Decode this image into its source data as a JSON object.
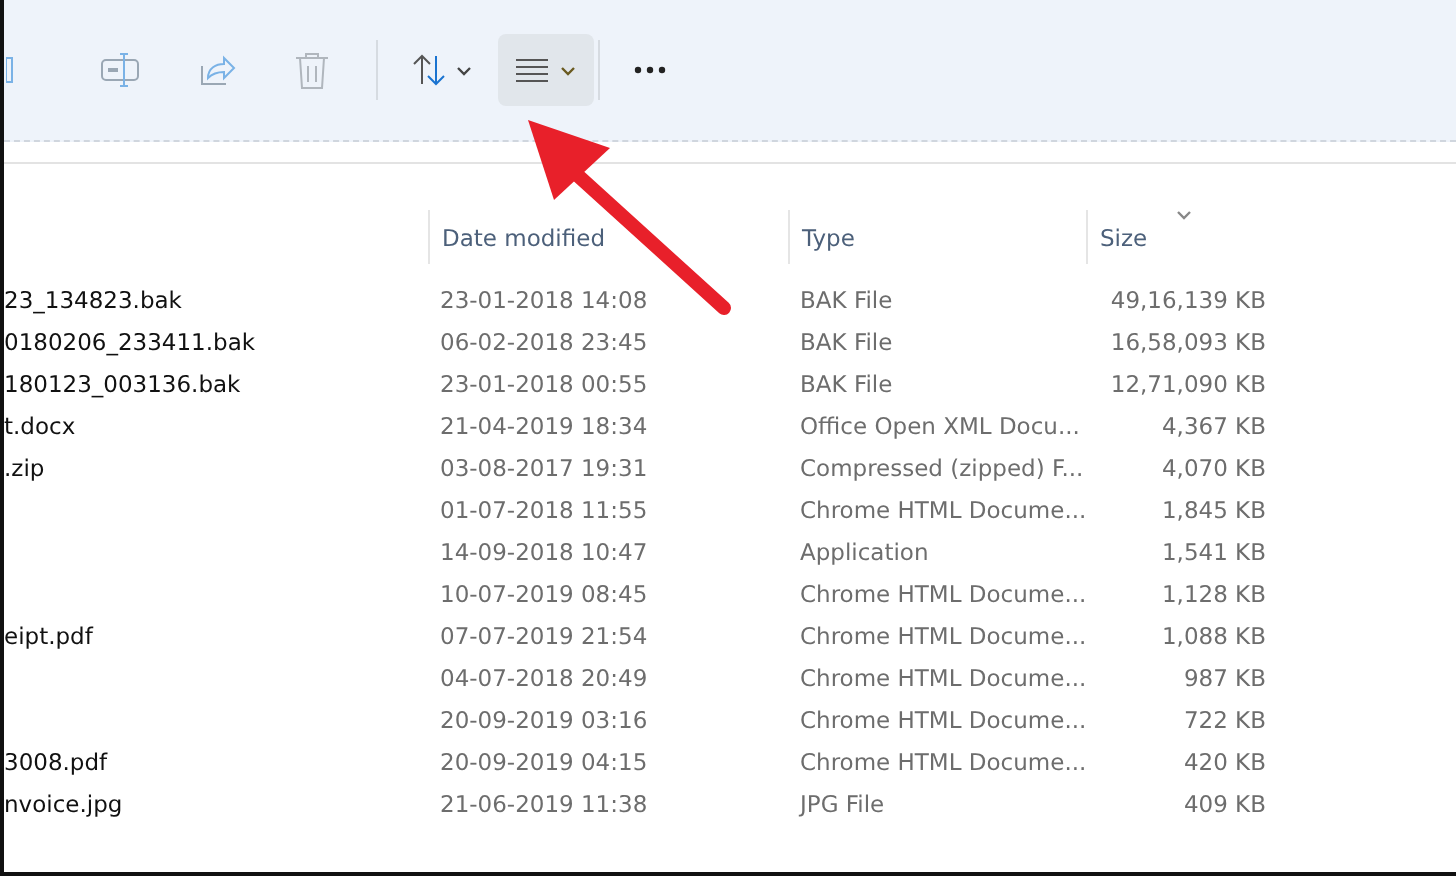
{
  "toolbar": {
    "view_button": {
      "selected": true
    }
  },
  "table": {
    "columns": [
      "Date modified",
      "Type",
      "Size"
    ],
    "rows": [
      {
        "name": "23_134823.bak",
        "date": "23-01-2018 14:08",
        "type": "BAK File",
        "size": "49,16,139 KB"
      },
      {
        "name": "0180206_233411.bak",
        "date": "06-02-2018 23:45",
        "type": "BAK File",
        "size": "16,58,093 KB"
      },
      {
        "name": "180123_003136.bak",
        "date": "23-01-2018 00:55",
        "type": "BAK File",
        "size": "12,71,090 KB"
      },
      {
        "name": "t.docx",
        "date": "21-04-2019 18:34",
        "type": "Office Open XML Docu...",
        "size": "4,367 KB"
      },
      {
        "name": ".zip",
        "date": "03-08-2017 19:31",
        "type": "Compressed (zipped) F...",
        "size": "4,070 KB"
      },
      {
        "date": "01-07-2018 11:55",
        "type": "Chrome HTML Docume...",
        "size": "1,845 KB"
      },
      {
        "date": "14-09-2018 10:47",
        "type": "Application",
        "size": "1,541 KB"
      },
      {
        "date": "10-07-2019 08:45",
        "type": "Chrome HTML Docume...",
        "size": "1,128 KB"
      },
      {
        "name": "eipt.pdf",
        "date": "07-07-2019 21:54",
        "type": "Chrome HTML Docume...",
        "size": "1,088 KB"
      },
      {
        "date": "04-07-2018 20:49",
        "type": "Chrome HTML Docume...",
        "size": "987 KB"
      },
      {
        "date": "20-09-2019 03:16",
        "type": "Chrome HTML Docume...",
        "size": "722 KB"
      },
      {
        "name": "3008.pdf",
        "date": "20-09-2019 04:15",
        "type": "Chrome HTML Docume...",
        "size": "420 KB"
      },
      {
        "name": "nvoice.jpg",
        "date": "21-06-2019 11:38",
        "type": "JPG File",
        "size": "409 KB"
      }
    ]
  }
}
